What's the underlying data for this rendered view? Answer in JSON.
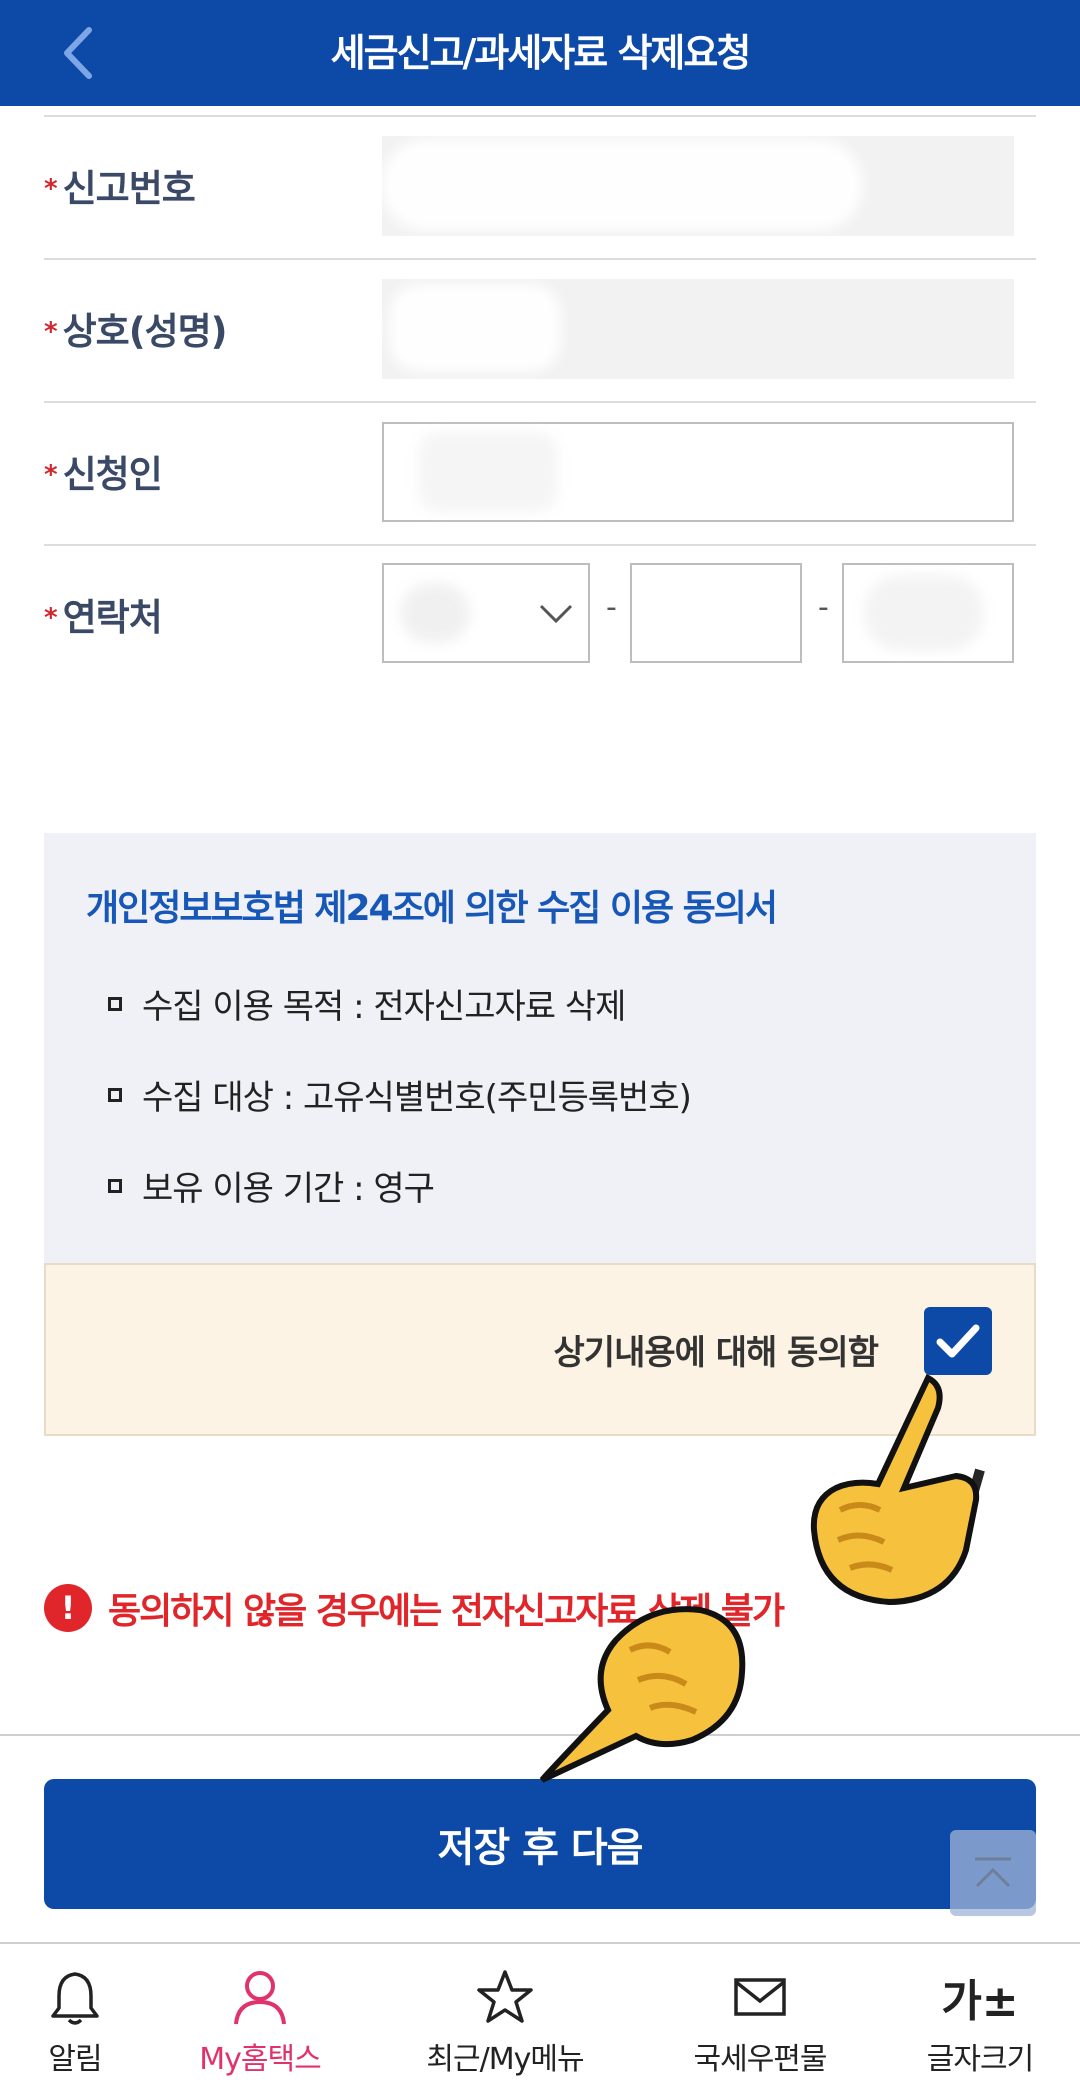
{
  "header": {
    "title": "세금신고/과세자료 삭제요청",
    "back_icon": "chevron-left-icon"
  },
  "form": {
    "required_mark": "*",
    "rows": [
      {
        "label": "신고번호"
      },
      {
        "label": "상호(성명)"
      },
      {
        "label": "신청인"
      },
      {
        "label": "연락처"
      }
    ],
    "phone_separator": "-"
  },
  "consent": {
    "title": "개인정보보호법 제24조에 의한 수집 이용 동의서",
    "items": [
      "수집 이용 목적 : 전자신고자료 삭제",
      "수집 대상 : 고유식별번호(주민등록번호)",
      "보유 이용 기간 : 영구"
    ]
  },
  "agree": {
    "label": "상기내용에 대해 동의함",
    "checked": true
  },
  "warning": {
    "text": "동의하지 않을 경우에는 전자신고자료 삭제 불가"
  },
  "save_button": {
    "label": "저장 후 다음"
  },
  "bottom_nav": {
    "items": [
      {
        "label": "알림",
        "icon": "bell-icon"
      },
      {
        "label": "My홈택스",
        "icon": "user-icon",
        "active": true
      },
      {
        "label": "최근/My메뉴",
        "icon": "star-icon"
      },
      {
        "label": "국세우편물",
        "icon": "mail-icon"
      },
      {
        "label": "글자크기",
        "icon": "font-size-icon",
        "glyph": "가±"
      }
    ]
  },
  "colors": {
    "primary": "#0d4aa8",
    "required": "#d0282c",
    "warning": "#e0262b",
    "active_nav": "#e0336b",
    "consent_bg": "#eff1f7",
    "agree_bg": "#fdf3e4"
  }
}
